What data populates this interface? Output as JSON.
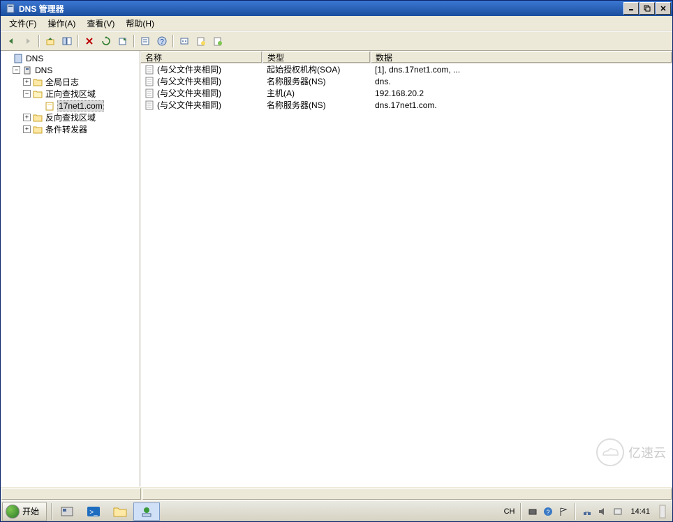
{
  "title": "DNS 管理器",
  "menus": {
    "file": "文件(F)",
    "action": "操作(A)",
    "view": "查看(V)",
    "help": "帮助(H)"
  },
  "tree": {
    "root": "DNS",
    "server": "DNS",
    "global_log": "全局日志",
    "fwd_zone": "正向查找区域",
    "zone_sel": "17net1.com",
    "rev_zone": "反向查找区域",
    "cond_fwd": "条件转发器"
  },
  "cols": {
    "name": "名称",
    "type": "类型",
    "data": "数据"
  },
  "records": [
    {
      "name": "(与父文件夹相同)",
      "type": "起始授权机构(SOA)",
      "data": "[1], dns.17net1.com, ..."
    },
    {
      "name": "(与父文件夹相同)",
      "type": "名称服务器(NS)",
      "data": "dns."
    },
    {
      "name": "(与父文件夹相同)",
      "type": "主机(A)",
      "data": "192.168.20.2"
    },
    {
      "name": "(与父文件夹相同)",
      "type": "名称服务器(NS)",
      "data": "dns.17net1.com."
    }
  ],
  "taskbar": {
    "start": "开始",
    "ime": "CH",
    "clock": "14:41"
  },
  "watermark": "亿速云"
}
